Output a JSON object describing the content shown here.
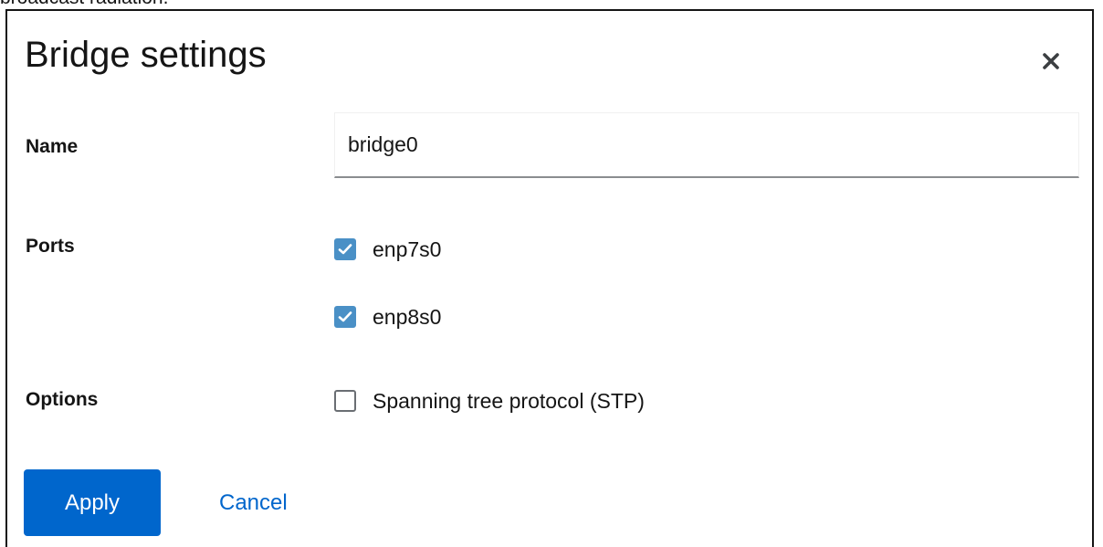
{
  "background_text": "broadcast radiation.",
  "dialog": {
    "title": "Bridge settings",
    "close_icon": "close-icon"
  },
  "form": {
    "name": {
      "label": "Name",
      "value": "bridge0"
    },
    "ports": {
      "label": "Ports",
      "items": [
        {
          "label": "enp7s0",
          "checked": true
        },
        {
          "label": "enp8s0",
          "checked": true
        }
      ]
    },
    "options": {
      "label": "Options",
      "items": [
        {
          "label": "Spanning tree protocol (STP)",
          "checked": false
        }
      ]
    }
  },
  "actions": {
    "apply_label": "Apply",
    "cancel_label": "Cancel"
  },
  "colors": {
    "primary": "#0066cc",
    "checkbox_checked": "#4a90c6"
  }
}
